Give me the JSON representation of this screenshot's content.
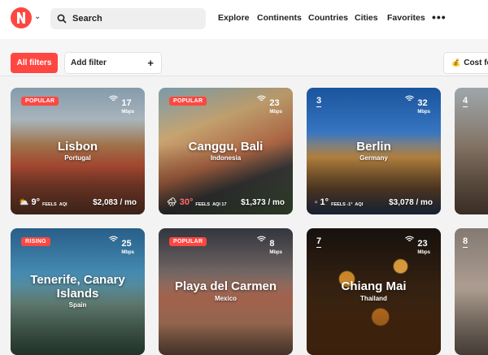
{
  "header": {
    "search_label": "Search",
    "nav": [
      "Explore",
      "Continents",
      "Countries",
      "Cities",
      "Favorites"
    ],
    "more_label": "•••"
  },
  "filters": {
    "all_label": "All filters",
    "add_label": "Add filter",
    "add_icon": "+",
    "cost_label": "Cost fo"
  },
  "colors": {
    "accent": "#ff4742"
  },
  "cards": [
    {
      "badge": "POPULAR",
      "city": "Lisbon",
      "country": "Portugal",
      "speed": "17",
      "speed_unit": "Mbps",
      "temp": "9°",
      "feels": "FEELS",
      "aqi": "AQI",
      "cost": "$2,083 / mo"
    },
    {
      "badge": "POPULAR",
      "city": "Canggu, Bali",
      "country": "Indonesia",
      "speed": "23",
      "speed_unit": "Mbps",
      "temp": "30°",
      "feels": "FEELS",
      "aqi": "AQI 17",
      "cost": "$1,373 / mo"
    },
    {
      "badge": "3",
      "city": "Berlin",
      "country": "Germany",
      "speed": "32",
      "speed_unit": "Mbps",
      "temp": "1°",
      "feels": "FEELS -1°",
      "aqi": "AQI",
      "cost": "$3,078 / mo"
    },
    {
      "badge": "4",
      "city": "",
      "country": "",
      "speed": "",
      "speed_unit": "",
      "temp": "",
      "feels": "",
      "aqi": "",
      "cost": ""
    },
    {
      "badge": "RISING",
      "city": "Tenerife, Canary Islands",
      "country": "Spain",
      "speed": "25",
      "speed_unit": "Mbps",
      "temp": "",
      "feels": "",
      "aqi": "",
      "cost": ""
    },
    {
      "badge": "POPULAR",
      "city": "Playa del Carmen",
      "country": "Mexico",
      "speed": "8",
      "speed_unit": "Mbps",
      "temp": "",
      "feels": "",
      "aqi": "",
      "cost": ""
    },
    {
      "badge": "7",
      "city": "Chiang Mai",
      "country": "Thailand",
      "speed": "23",
      "speed_unit": "Mbps",
      "temp": "",
      "feels": "",
      "aqi": "",
      "cost": ""
    },
    {
      "badge": "8",
      "city": "",
      "country": "",
      "speed": "",
      "speed_unit": "",
      "temp": "",
      "feels": "",
      "aqi": "",
      "cost": ""
    }
  ]
}
